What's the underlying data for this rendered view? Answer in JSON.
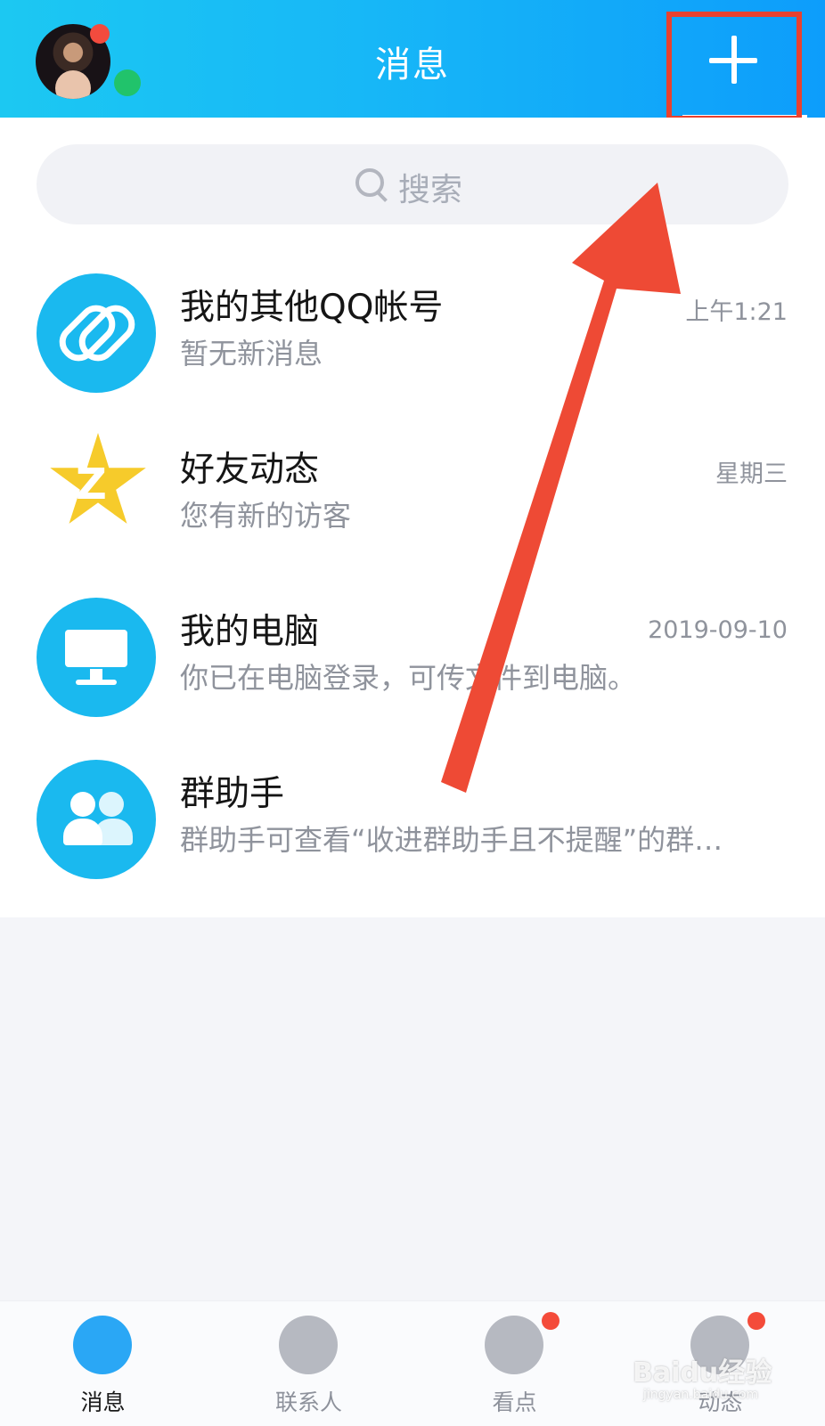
{
  "header": {
    "title": "消息",
    "add_button_glyph": "+",
    "colors": {
      "gradient_start": "#1cc8f2",
      "gradient_end": "#0d9dfb",
      "highlight": "#e8412f"
    }
  },
  "search": {
    "placeholder": "搜索",
    "icon": "search-icon"
  },
  "conversations": [
    {
      "name": "我的其他QQ帐号",
      "preview": "暂无新消息",
      "time": "上午1:21",
      "icon": "link-icon"
    },
    {
      "name": "好友动态",
      "preview": "您有新的访客",
      "time": "星期三",
      "icon": "qzone-star-icon"
    },
    {
      "name": "我的电脑",
      "preview": "你已在电脑登录，可传文件到电脑。",
      "time": "2019-09-10",
      "icon": "computer-icon"
    },
    {
      "name": "群助手",
      "preview": "群助手可查看“收进群助手且不提醒”的群…",
      "time": "",
      "icon": "group-icon"
    }
  ],
  "tabs": [
    {
      "label": "消息",
      "icon": "message-icon",
      "active": true,
      "badge": false
    },
    {
      "label": "联系人",
      "icon": "contacts-icon",
      "active": false,
      "badge": false
    },
    {
      "label": "看点",
      "icon": "eye-icon",
      "active": false,
      "badge": true
    },
    {
      "label": "动态",
      "icon": "planet-icon",
      "active": false,
      "badge": true
    }
  ],
  "watermark": {
    "brand": "Baidu经验",
    "url": "jingyan.baidu.com"
  }
}
